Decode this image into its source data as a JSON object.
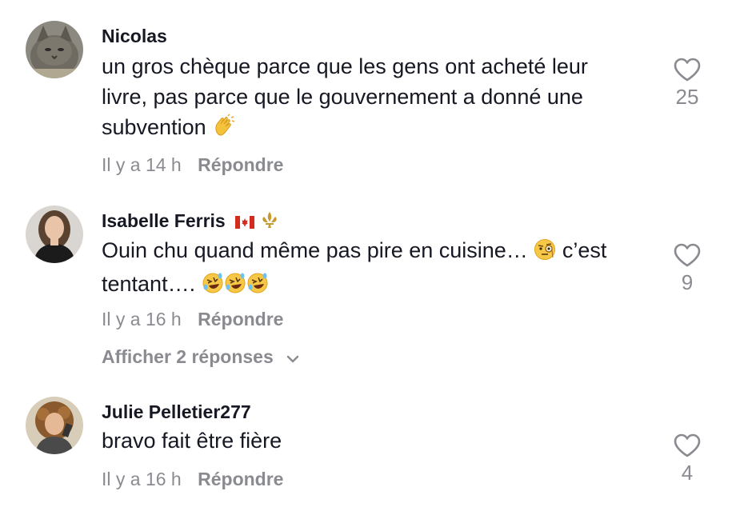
{
  "comments": [
    {
      "username": "Nicolas",
      "text_line1": "un gros chèque parce que les gens ont acheté leur",
      "text_line2": "livre, pas parce que le gouvernement a donné une",
      "text_line3": "subvention",
      "time": "Il y a 14 h",
      "reply_label": "Répondre",
      "likes": "25"
    },
    {
      "username": "Isabelle Ferris",
      "text_line1": "Ouin chu quand même pas pire en cuisine…",
      "text_line1b": "c’est",
      "text_line2": "tentant….",
      "time": "Il y a 16 h",
      "reply_label": "Répondre",
      "likes": "9",
      "view_replies": "Afficher 2 réponses"
    },
    {
      "username": "Julie Pelletier277",
      "text_line1": "bravo fait être fière",
      "time": "Il y a 16 h",
      "reply_label": "Répondre",
      "likes": "4"
    }
  ],
  "colors": {
    "primary_text": "#161823",
    "secondary_text": "#8a8b91",
    "background": "#ffffff"
  },
  "icons": [
    "heart-outline-icon",
    "chevron-down-icon",
    "clapping-hands-emoji",
    "face-with-monocle-emoji",
    "rolling-laughing-emoji",
    "canada-flag-emoji",
    "fleur-de-lis-emoji"
  ]
}
